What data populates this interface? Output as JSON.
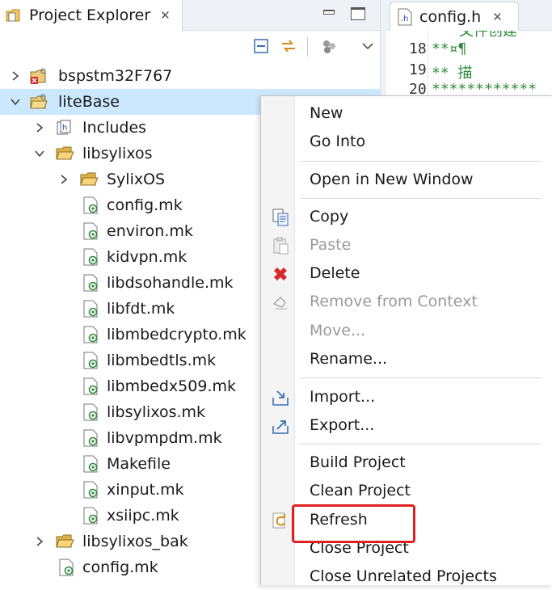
{
  "project_explorer": {
    "tab_title": "Project Explorer",
    "tab_close": "✕"
  },
  "tree": [
    {
      "label": "bspstm32F767",
      "expanded": false,
      "icon": "project-error-icon"
    },
    {
      "label": "liteBase",
      "expanded": true,
      "icon": "project-c-icon",
      "selected": true
    },
    {
      "label": "Includes",
      "expanded": false,
      "icon": "includes-icon"
    },
    {
      "label": "libsylixos",
      "expanded": true,
      "icon": "folder-icon"
    },
    {
      "label": "SylixOS",
      "expanded": false,
      "icon": "folder-icon"
    },
    {
      "label": "config.mk",
      "icon": "makefile-icon"
    },
    {
      "label": "environ.mk",
      "icon": "makefile-icon"
    },
    {
      "label": "kidvpn.mk",
      "icon": "makefile-icon"
    },
    {
      "label": "libdsohandle.mk",
      "icon": "makefile-icon"
    },
    {
      "label": "libfdt.mk",
      "icon": "makefile-icon"
    },
    {
      "label": "libmbedcrypto.mk",
      "icon": "makefile-icon"
    },
    {
      "label": "libmbedtls.mk",
      "icon": "makefile-icon"
    },
    {
      "label": "libmbedx509.mk",
      "icon": "makefile-icon"
    },
    {
      "label": "libsylixos.mk",
      "icon": "makefile-icon"
    },
    {
      "label": "libvpmpdm.mk",
      "icon": "makefile-icon"
    },
    {
      "label": "Makefile",
      "icon": "makefile-icon"
    },
    {
      "label": "xinput.mk",
      "icon": "makefile-icon"
    },
    {
      "label": "xsiipc.mk",
      "icon": "makefile-icon"
    },
    {
      "label": "libsylixos_bak",
      "expanded": false,
      "icon": "folder-icon"
    },
    {
      "label": "config.mk",
      "icon": "makefile-icon"
    }
  ],
  "editor": {
    "tab_title": "config.h",
    "tab_close": "✕",
    "lines": [
      {
        "num": "18",
        "text": "**¤¶"
      },
      {
        "num": "19",
        "text": "** 描"
      },
      {
        "num": "20",
        "text": "************"
      }
    ],
    "top_fragment": "文件创建"
  },
  "context_menu": {
    "items": [
      {
        "label": "New"
      },
      {
        "label": "Go Into"
      },
      {
        "label": "Open in New Window"
      },
      {
        "label": "Copy"
      },
      {
        "label": "Paste",
        "disabled": true
      },
      {
        "label": "Delete"
      },
      {
        "label": "Remove from Context",
        "disabled": true
      },
      {
        "label": "Move...",
        "disabled": true
      },
      {
        "label": "Rename..."
      },
      {
        "label": "Import..."
      },
      {
        "label": "Export..."
      },
      {
        "label": "Build Project"
      },
      {
        "label": "Clean Project"
      },
      {
        "label": "Refresh",
        "highlighted": true
      },
      {
        "label": "Close Project"
      },
      {
        "label": "Close Unrelated Projects"
      }
    ]
  },
  "colors": {
    "selection": "#cce8ff",
    "highlight_box": "#e02020",
    "code_comment": "#2e8b3a"
  }
}
